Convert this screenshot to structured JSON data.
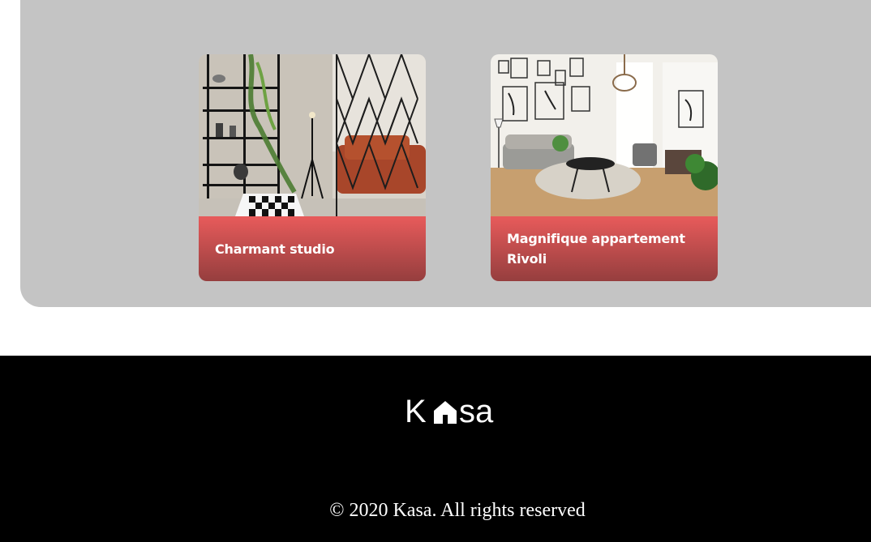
{
  "gallery": {
    "cards": [
      {
        "title": "Charmant studio",
        "image": "studio-living-room-photo"
      },
      {
        "title": "Magnifique appartement Rivoli",
        "image": "apartment-living-room-photo"
      }
    ]
  },
  "footer": {
    "logo_text": "Kasa",
    "logo_icon": "house-icon",
    "copyright": "© 2020 Kasa. All rights reserved"
  },
  "colors": {
    "gallery_background": "#c4c4c4",
    "card_caption_top": "#e85b5b",
    "card_caption_bottom": "#963e3e",
    "footer_background": "#000000",
    "text": "#ffffff"
  }
}
